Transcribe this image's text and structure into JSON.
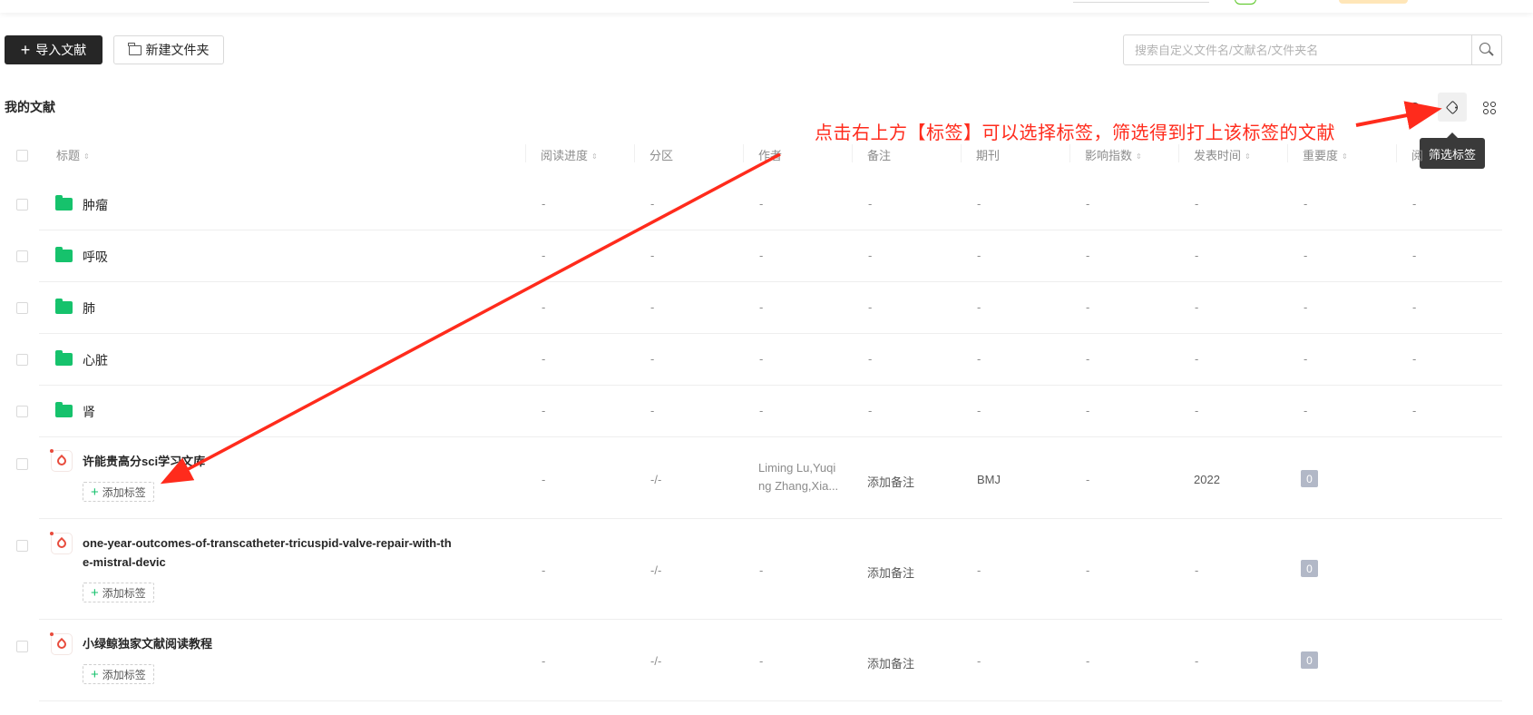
{
  "toolbar": {
    "import_label": "导入文献",
    "new_folder_label": "新建文件夹",
    "search_placeholder": "搜索自定义文件名/文献名/文件夹名"
  },
  "section_title": "我的文献",
  "tooltip": "筛选标签",
  "annotation": "点击右上方【标签】可以选择标签，筛选得到打上该标签的文献",
  "columns": {
    "title": "标题",
    "progress": "阅读进度",
    "zone": "分区",
    "author": "作者",
    "note": "备注",
    "journal": "期刊",
    "impact": "影响指数",
    "date": "发表时间",
    "importance": "重要度",
    "read": "阅"
  },
  "folders": [
    {
      "name": "肿瘤",
      "cells": [
        "-",
        "-",
        "-",
        "-",
        "-",
        "-",
        "-",
        "-",
        "-"
      ]
    },
    {
      "name": "呼吸",
      "cells": [
        "-",
        "-",
        "-",
        "-",
        "-",
        "-",
        "-",
        "-",
        "-"
      ]
    },
    {
      "name": "肺",
      "cells": [
        "-",
        "-",
        "-",
        "-",
        "-",
        "-",
        "-",
        "-",
        "-"
      ]
    },
    {
      "name": "心脏",
      "cells": [
        "-",
        "-",
        "-",
        "-",
        "-",
        "-",
        "-",
        "-",
        "-"
      ]
    },
    {
      "name": "肾",
      "cells": [
        "-",
        "-",
        "-",
        "-",
        "-",
        "-",
        "-",
        "-",
        "-"
      ]
    }
  ],
  "docs": [
    {
      "title": "许能贵高分sci学习文库",
      "add_tag": "添加标签",
      "progress": "-",
      "zone": "-/-",
      "author_line1": "Liming Lu,Yuqi",
      "author_line2": "ng Zhang,Xia...",
      "note": "添加备注",
      "journal": "BMJ",
      "impact": "-",
      "date": "2022",
      "importance": "0"
    },
    {
      "title_line1": "one-year-outcomes-of-transcatheter-tricuspid-valve-repair-with-th",
      "title_line2": "e-mistral-devic",
      "add_tag": "添加标签",
      "progress": "-",
      "zone": "-/-",
      "author": "-",
      "note": "添加备注",
      "journal": "-",
      "impact": "-",
      "date": "-",
      "importance": "0"
    },
    {
      "title": "小绿鲸独家文献阅读教程",
      "add_tag": "添加标签",
      "progress": "-",
      "zone": "-/-",
      "author": "-",
      "note": "添加备注",
      "journal": "-",
      "impact": "-",
      "date": "-",
      "importance": "0"
    }
  ],
  "colors": {
    "accent_green": "#16c26c",
    "annotation_red": "#ff2b1c",
    "primary_button": "#262626",
    "importance_badge": "#b2b8c7"
  }
}
